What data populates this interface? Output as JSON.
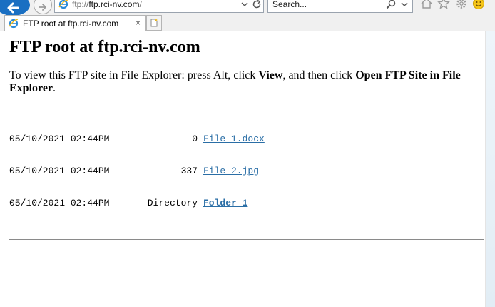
{
  "browser": {
    "address_host_prefix": "ftp://",
    "address_host_bold": "ftp.rci-nv.com",
    "address_suffix": "/",
    "search_placeholder": "Search...",
    "tab_title": "FTP root at ftp.rci-nv.com",
    "tab_close": "×",
    "icons": [
      "back-arrow-icon",
      "forward-arrow-icon",
      "ie-logo-icon",
      "dropdown-icon",
      "refresh-icon",
      "search-icon",
      "home-icon",
      "favorites-star-icon",
      "settings-gear-icon",
      "smiley-feedback-icon",
      "new-tab-icon"
    ],
    "accent_color": "#1a6fc2"
  },
  "page": {
    "title": "FTP root at ftp.rci-nv.com",
    "instr_pre": "To view this FTP site in File Explorer: press Alt, click ",
    "instr_view": "View",
    "instr_mid": ", and then click ",
    "instr_open": "Open FTP Site in File Explorer",
    "instr_end": ".",
    "entries": [
      {
        "date": "05/10/2021 02:44PM",
        "size": "0",
        "name": "File 1.docx"
      },
      {
        "date": "05/10/2021 02:44PM",
        "size": "337",
        "name": "File 2.jpg"
      },
      {
        "date": "05/10/2021 02:44PM",
        "size": "Directory",
        "name": "Folder 1"
      }
    ],
    "link_color": "#2a6ea6"
  }
}
